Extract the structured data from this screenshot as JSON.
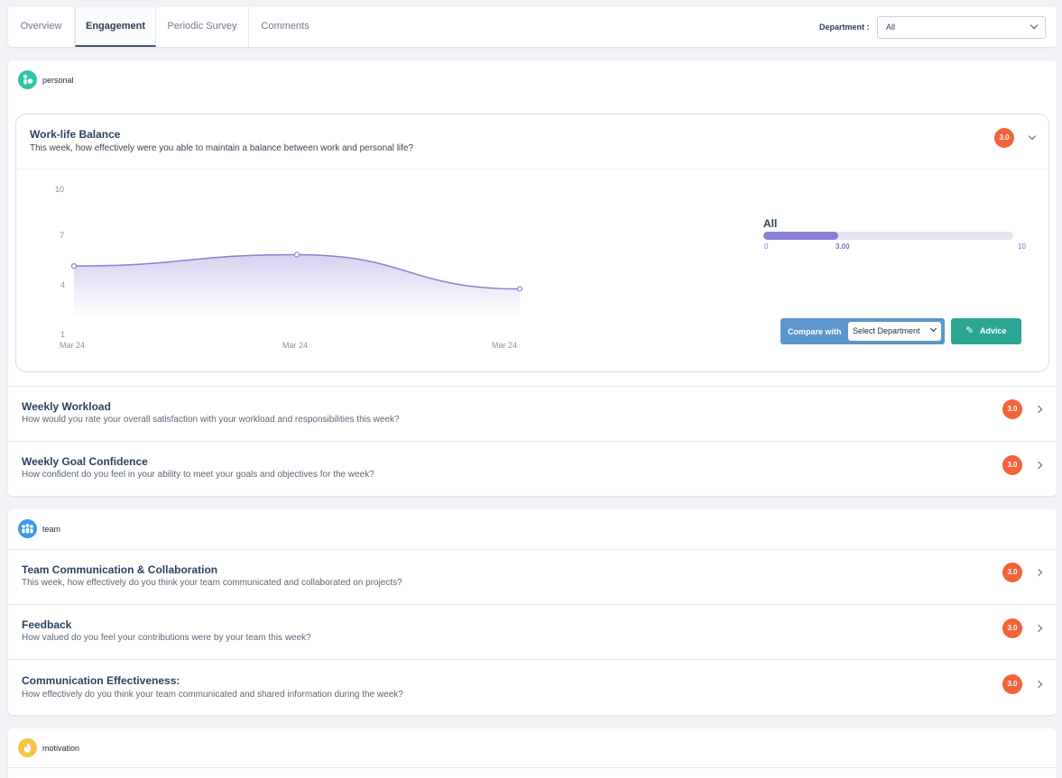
{
  "tabs": {
    "items": [
      {
        "label": "Overview"
      },
      {
        "label": "Engagement"
      },
      {
        "label": "Periodic Survey"
      },
      {
        "label": "Comments"
      }
    ],
    "active_index": 1
  },
  "filter": {
    "department_label": "Department :",
    "department_value": "All"
  },
  "sections": {
    "personal": {
      "title": "personal",
      "icon": "person-icon",
      "icon_color": "#2dc6a8",
      "expanded_question": {
        "title": "Work-life Balance",
        "description": "This week, how effectively were you able to maintain a balance between work and personal life?",
        "score": "3.0",
        "chart": {
          "y_ticks": [
            "10",
            "7",
            "4",
            "1"
          ],
          "x_ticks": [
            "Mar 24",
            "Mar 24",
            "Mar 24"
          ]
        },
        "summary": {
          "label": "All",
          "min": "0",
          "value": "3.00",
          "max": "10"
        },
        "compare_label": "Compare with",
        "compare_placeholder": "Select Department",
        "advice_label": "Advice"
      },
      "rows": [
        {
          "title": "Weekly Workload",
          "description": "How would you rate your overall satisfaction with your workload and responsibilities this week?",
          "score": "3.0"
        },
        {
          "title": "Weekly Goal Confidence",
          "description": "How confident do you feel in your ability to meet your goals and objectives for the week?",
          "score": "3.0"
        }
      ]
    },
    "team": {
      "title": "team",
      "icon": "team-icon",
      "icon_color": "#3d9be9",
      "rows": [
        {
          "title": "Team Communication & Collaboration",
          "description": "This week, how effectively do you think your team communicated and collaborated on projects?",
          "score": "3.0"
        },
        {
          "title": "Feedback",
          "description": "How valued do you feel your contributions were by your team this week?",
          "score": "3.0"
        },
        {
          "title": "Communication Effectiveness:",
          "description": "How effectively do you think your team communicated and shared information during the week?",
          "score": "3.0"
        }
      ]
    },
    "motivation": {
      "title": "motivation",
      "icon": "motivation-icon",
      "icon_color": "#f7c347"
    }
  },
  "chart_data": {
    "type": "area",
    "x": [
      "Mar 24",
      "Mar 24",
      "Mar 24"
    ],
    "values": [
      5.3,
      6.0,
      3.9
    ],
    "ylim": [
      1,
      10
    ],
    "y_ticks": [
      10,
      7,
      4,
      1
    ],
    "color": "#8a80d4"
  },
  "colors": {
    "score_badge": "#f4623a",
    "compare_button": "#5b96cc",
    "advice_button": "#2aa693",
    "progress_fill": "#8a80d4",
    "progress_value": 0.3
  }
}
